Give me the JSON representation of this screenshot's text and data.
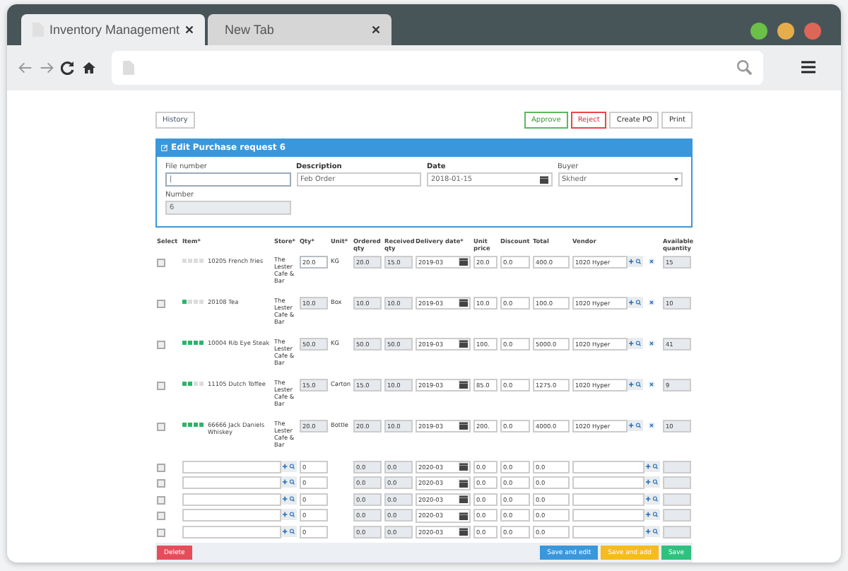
{
  "browser": {
    "tabs": [
      {
        "title": "Inventory Management",
        "selected": true
      },
      {
        "title": "New Tab",
        "selected": false
      }
    ]
  },
  "top_buttons": [
    {
      "label": "History",
      "kind": "plain"
    }
  ],
  "actions": [
    {
      "label": "Approve",
      "kind": "approve"
    },
    {
      "label": "Reject",
      "kind": "reject"
    },
    {
      "label": "Create PO",
      "kind": "plain"
    },
    {
      "label": "Print",
      "kind": "plain"
    }
  ],
  "panel": {
    "title": "Edit Purchase request 6",
    "fields": [
      {
        "label": "File number",
        "value": "|",
        "kind": "text",
        "bold": false
      },
      {
        "label": "Description",
        "value": "Feb Order",
        "kind": "text",
        "bold": true
      },
      {
        "label": "Date",
        "value": "2018-01-15",
        "kind": "date",
        "bold": true
      },
      {
        "label": "Buyer",
        "value": "Skhedr",
        "kind": "select",
        "bold": false
      },
      {
        "label": "Number",
        "value": "6",
        "kind": "readonly",
        "bold": false
      }
    ]
  },
  "table": {
    "columns": [
      "Select",
      "Item*",
      "Store*",
      "Qty*",
      "Unit*",
      "Ordered qty",
      "Received qty",
      "Delivery date*",
      "Unit price",
      "Discount",
      "Total",
      "Vendor",
      "",
      "Available quantity"
    ],
    "rows": [
      {
        "kind": "item",
        "checked": false,
        "level": 0,
        "item": "10205 French fries",
        "store": "The Lester Cafe & Bar",
        "qty": "20.0",
        "qty_editable": true,
        "unit": "KG",
        "ordered": "20.0",
        "received": "15.0",
        "delivery": "2019-03",
        "price": "20.0",
        "discount": "0.0",
        "total": "400.0",
        "vendor": "1020 Hyper",
        "available": "15"
      },
      {
        "kind": "item",
        "checked": false,
        "level": 0.25,
        "item": "20108 Tea",
        "store": "The Lester Cafe & Bar",
        "qty": "10.0",
        "qty_editable": false,
        "unit": "Box",
        "ordered": "10.0",
        "received": "10.0",
        "delivery": "2019-03",
        "price": "10.0",
        "discount": "0.0",
        "total": "100.0",
        "vendor": "1020 Hyper",
        "available": "10"
      },
      {
        "kind": "item",
        "checked": false,
        "level": 1,
        "item": "10004 Rib Eye Steak",
        "store": "The Lester Cafe & Bar",
        "qty": "50.0",
        "qty_editable": false,
        "unit": "KG",
        "ordered": "50.0",
        "received": "50.0",
        "delivery": "2019-03",
        "price": "100.",
        "discount": "0.0",
        "total": "5000.0",
        "vendor": "1020 Hyper",
        "available": "41"
      },
      {
        "kind": "item",
        "checked": false,
        "level": 0.5,
        "item": "11105 Dutch Toffee",
        "store": "The Lester Cafe & Bar",
        "qty": "15.0",
        "qty_editable": false,
        "unit": "Carton",
        "ordered": "15.0",
        "received": "10.0",
        "delivery": "2019-03",
        "price": "85.0",
        "discount": "0.0",
        "total": "1275.0",
        "vendor": "1020 Hyper",
        "available": "9"
      },
      {
        "kind": "item",
        "checked": false,
        "level": 1,
        "item": "66666 Jack Daniels Whiskey",
        "store": "The Lester Cafe & Bar",
        "qty": "20.0",
        "qty_editable": false,
        "unit": "Bottle",
        "ordered": "20.0",
        "received": "10.0",
        "delivery": "2019-03",
        "price": "200.",
        "discount": "0.0",
        "total": "4000.0",
        "vendor": "1020 Hyper",
        "available": "10"
      },
      {
        "kind": "blank",
        "checked": false,
        "qty": "0",
        "ordered": "0.0",
        "received": "0.0",
        "delivery": "2020-03",
        "price": "0.0",
        "discount": "0.0",
        "total": "0.0"
      },
      {
        "kind": "blank",
        "checked": false,
        "qty": "0",
        "ordered": "0.0",
        "received": "0.0",
        "delivery": "2020-03",
        "price": "0.0",
        "discount": "0.0",
        "total": "0.0"
      },
      {
        "kind": "blank",
        "checked": false,
        "qty": "0",
        "ordered": "0.0",
        "received": "0.0",
        "delivery": "2020-03",
        "price": "0.0",
        "discount": "0.0",
        "total": "0.0"
      },
      {
        "kind": "blank",
        "checked": false,
        "qty": "0",
        "ordered": "0.0",
        "received": "0.0",
        "delivery": "2020-03",
        "price": "0.0",
        "discount": "0.0",
        "total": "0.0"
      },
      {
        "kind": "blank",
        "checked": false,
        "qty": "0",
        "ordered": "0.0",
        "received": "0.0",
        "delivery": "2020-03",
        "price": "0.0",
        "discount": "0.0",
        "total": "0.0"
      }
    ]
  },
  "footer": [
    {
      "label": "Delete",
      "kind": "danger"
    },
    {
      "label": "Save and edit",
      "kind": "primary"
    },
    {
      "label": "Save and add",
      "kind": "warning"
    },
    {
      "label": "Save",
      "kind": "success"
    }
  ]
}
